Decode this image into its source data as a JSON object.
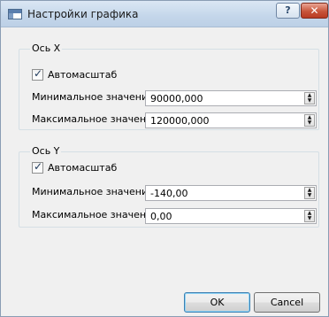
{
  "window": {
    "title": "Настройки графика",
    "help_label": "?",
    "close_label": "✕"
  },
  "axis_x": {
    "title": "Ось X",
    "autoscale": {
      "label": "Автомасштаб",
      "checked": true
    },
    "min": {
      "label": "Минимальное значение",
      "value": "90000,000"
    },
    "max": {
      "label": "Максимальное значение",
      "value": "120000,000"
    }
  },
  "axis_y": {
    "title": "Ось Y",
    "autoscale": {
      "label": "Автомасштаб",
      "checked": true
    },
    "min": {
      "label": "Минимальное значение",
      "value": "-140,00"
    },
    "max": {
      "label": "Максимальное значение",
      "value": "0,00"
    }
  },
  "buttons": {
    "ok": "OK",
    "cancel": "Cancel"
  },
  "glyphs": {
    "check": "✓",
    "up": "▲",
    "down": "▼"
  }
}
